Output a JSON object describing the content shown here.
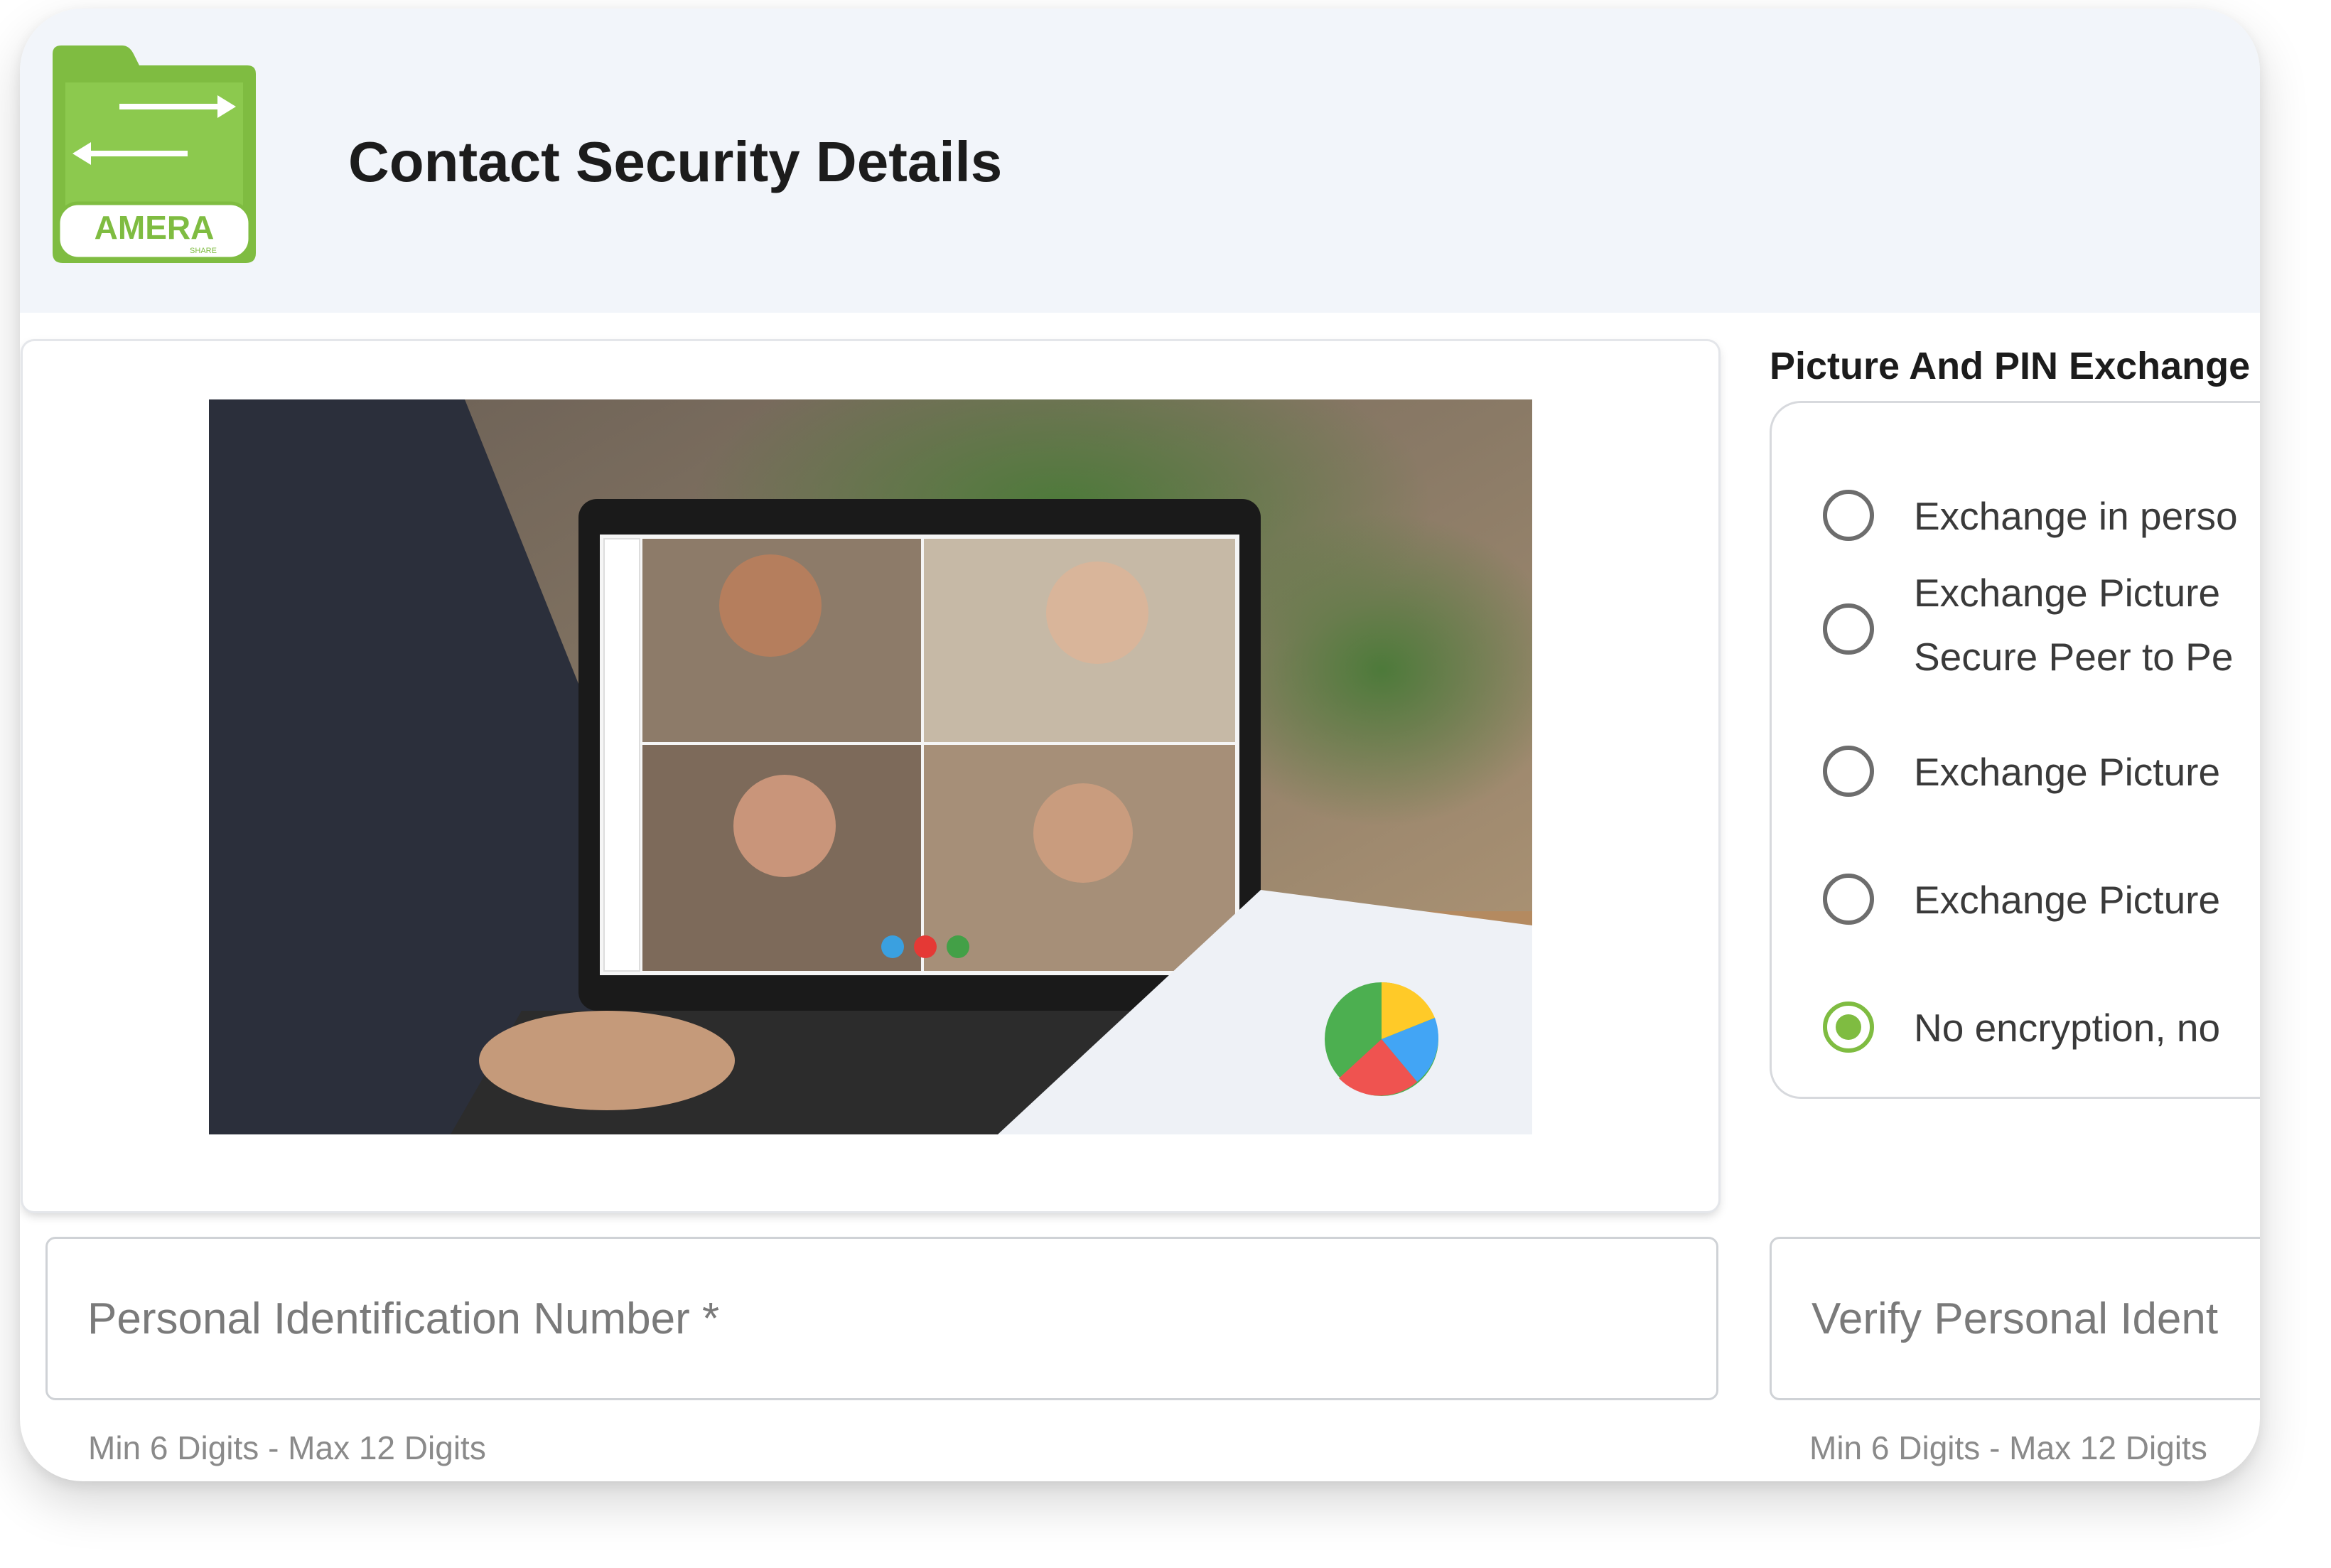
{
  "header": {
    "logo_text": "AMERA",
    "logo_subtext": "SHARE",
    "title": "Contact Security Details"
  },
  "exchange": {
    "title": "Picture And PIN Exchange",
    "options": [
      {
        "label_lines": [
          "Exchange in perso"
        ],
        "checked": false
      },
      {
        "label_lines": [
          "Exchange Picture",
          "Secure Peer to Pe"
        ],
        "checked": false
      },
      {
        "label_lines": [
          "Exchange Picture"
        ],
        "checked": false
      },
      {
        "label_lines": [
          "Exchange Picture"
        ],
        "checked": false
      },
      {
        "label_lines": [
          "No encryption, no"
        ],
        "checked": true
      }
    ]
  },
  "pin_field": {
    "placeholder": "Personal Identification Number *",
    "value": "",
    "helper": "Min 6 Digits - Max 12 Digits"
  },
  "verify_pin_field": {
    "placeholder": "Verify Personal Ident",
    "value": "",
    "helper": "Min 6 Digits - Max 12 Digits"
  },
  "colors": {
    "brand_green": "#7fbc41",
    "header_bg": "#f2f5fa",
    "title_text": "#1c1c1c"
  }
}
